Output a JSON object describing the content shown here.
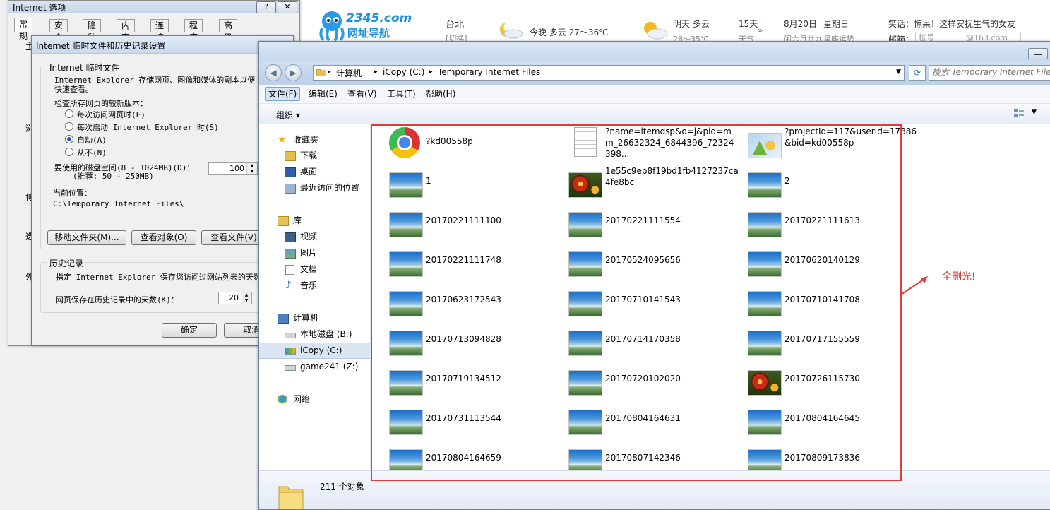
{
  "browser": {
    "brand": "2345.com",
    "slogan": "网址导航",
    "city": "台北",
    "city_sub": "[切换]",
    "tonight": "今晚 多云 27～36℃",
    "tomorrow": "明天 多云",
    "tomorrow_sub": "28～35℃",
    "days15": "15天",
    "days15_sub": "天气",
    "date": "8月20日",
    "weekday": "星期日",
    "lunar": "闰六月廿九",
    "constellation": "星座运势",
    "joke": "笑话：惊呆！这样安抚生气的女友",
    "mail_label": "邮箱：",
    "mail_account": "帐号",
    "mail_domain": "@163.com"
  },
  "internet_options": {
    "title": "Internet 选项",
    "help_btn": "?",
    "close_btn": "✕",
    "tabs": [
      "常规",
      "安全",
      "隐私",
      "内容",
      "连接",
      "程序",
      "高级"
    ],
    "side_chars": [
      "主",
      "浏",
      "搜",
      "选",
      "外"
    ]
  },
  "temp_dialog": {
    "title": "Internet 临时文件和历史记录设置",
    "group_temp": "Internet 临时文件",
    "desc_line1": "Internet Explorer 存储网页、图像和媒体的副本以便",
    "desc_line2": "快速查看。",
    "check_label": "检查所存网页的较新版本：",
    "radios": [
      {
        "label": "每次访问网页时(E)",
        "checked": false
      },
      {
        "label": "每次启动 Internet Explorer 时(S)",
        "checked": false
      },
      {
        "label": "自动(A)",
        "checked": true
      },
      {
        "label": "从不(N)",
        "checked": false
      }
    ],
    "disk_label": "要使用的磁盘空间(8 - 1024MB)(D)：",
    "disk_hint": "(推荐: 50 - 250MB)",
    "disk_value": "100",
    "location_label": "当前位置：",
    "location_value": "C:\\Temporary Internet Files\\",
    "btn_move": "移动文件夹(M)...",
    "btn_view_objects": "查看对象(O)",
    "btn_view_files": "查看文件(V)",
    "group_history": "历史记录",
    "history_desc": "指定 Internet Explorer 保存您访问过网站列表的天数",
    "history_days_label": "网页保存在历史记录中的天数(K)：",
    "history_days_value": "20",
    "btn_ok": "确定",
    "btn_cancel": "取消"
  },
  "explorer": {
    "breadcrumb": [
      "计算机",
      "iCopy (C:)",
      "Temporary Internet Files"
    ],
    "search_placeholder": "搜索 Temporary Internet Files",
    "menu": [
      "文件(F)",
      "编辑(E)",
      "查看(V)",
      "工具(T)",
      "帮助(H)"
    ],
    "organize": "组织 ▾",
    "nav": [
      {
        "label": "收藏夹",
        "icon": "star-icon"
      },
      {
        "label": "下载",
        "icon": "download-folder-icon"
      },
      {
        "label": "桌面",
        "icon": "desktop-icon"
      },
      {
        "label": "最近访问的位置",
        "icon": "recent-places-icon"
      },
      {
        "label": "库",
        "icon": "library-icon"
      },
      {
        "label": "视频",
        "icon": "video-icon"
      },
      {
        "label": "图片",
        "icon": "pictures-icon"
      },
      {
        "label": "文档",
        "icon": "documents-icon"
      },
      {
        "label": "音乐",
        "icon": "music-icon"
      },
      {
        "label": "计算机",
        "icon": "computer-icon"
      },
      {
        "label": "本地磁盘 (B:)",
        "icon": "drive-icon"
      },
      {
        "label": "iCopy (C:)",
        "icon": "system-drive-icon"
      },
      {
        "label": "game241 (Z:)",
        "icon": "network-drive-icon"
      },
      {
        "label": "网络",
        "icon": "network-icon"
      }
    ],
    "files": [
      {
        "name": "?kd00558p",
        "icon": "chrome"
      },
      {
        "name": "?name=itemdsp&o=j&pid=mm_26632324_6844396_72324398...",
        "icon": "doc"
      },
      {
        "name": "?projectId=117&userId=17886&bid=kd00558p",
        "icon": "app"
      },
      {
        "name": "1",
        "icon": "landscape"
      },
      {
        "name": "1e55c9eb8f19bd1fb4127237ca4fe8bc",
        "icon": "flower"
      },
      {
        "name": "2",
        "icon": "landscape"
      },
      {
        "name": "20170221111100",
        "icon": "landscape"
      },
      {
        "name": "20170221111554",
        "icon": "landscape"
      },
      {
        "name": "20170221111613",
        "icon": "landscape"
      },
      {
        "name": "20170221111748",
        "icon": "landscape"
      },
      {
        "name": "20170524095656",
        "icon": "landscape"
      },
      {
        "name": "20170620140129",
        "icon": "landscape"
      },
      {
        "name": "20170623172543",
        "icon": "landscape"
      },
      {
        "name": "20170710141543",
        "icon": "landscape"
      },
      {
        "name": "20170710141708",
        "icon": "landscape"
      },
      {
        "name": "20170713094828",
        "icon": "landscape"
      },
      {
        "name": "20170714170358",
        "icon": "landscape"
      },
      {
        "name": "20170717155559",
        "icon": "landscape"
      },
      {
        "name": "20170719134512",
        "icon": "landscape"
      },
      {
        "name": "20170720102020",
        "icon": "landscape"
      },
      {
        "name": "20170726115730",
        "icon": "flower"
      },
      {
        "name": "20170731113544",
        "icon": "landscape"
      },
      {
        "name": "20170804164631",
        "icon": "landscape"
      },
      {
        "name": "20170804164645",
        "icon": "landscape"
      },
      {
        "name": "20170804164659",
        "icon": "landscape"
      },
      {
        "name": "20170807142346",
        "icon": "landscape"
      },
      {
        "name": "20170809173836",
        "icon": "landscape"
      }
    ],
    "status": "211 个对象"
  },
  "annotation": {
    "note": "全删光!",
    "color": "#e1201d"
  }
}
